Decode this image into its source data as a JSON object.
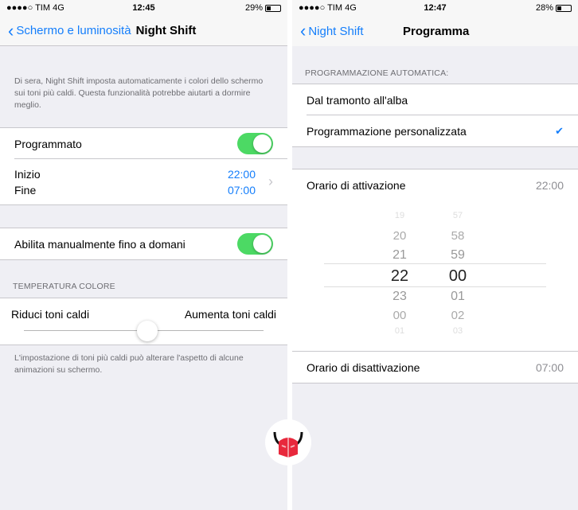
{
  "left": {
    "status": {
      "carrier": "●●●●○ TIM  4G",
      "time": "12:45",
      "battery": "29%",
      "battery_level": 0.29
    },
    "nav": {
      "back": "Schermo e luminosità",
      "title": "Night Shift"
    },
    "description": "Di sera, Night Shift imposta automaticamente i colori dello schermo sui toni più caldi. Questa funzionalità potrebbe aiutarti a dormire meglio.",
    "scheduled": {
      "label": "Programmato",
      "on": true
    },
    "start_label": "Inizio",
    "start_value": "22:00",
    "end_label": "Fine",
    "end_value": "07:00",
    "manual": {
      "label": "Abilita manualmente fino a domani",
      "on": true
    },
    "temp_header": "TEMPERATURA COLORE",
    "less_warm": "Riduci toni caldi",
    "more_warm": "Aumenta toni caldi",
    "temperature_level": 0.5,
    "temp_note": "L'impostazione di toni più caldi può alterare l'aspetto di alcune animazioni su schermo."
  },
  "right": {
    "status": {
      "carrier": "●●●●○ TIM  4G",
      "time": "12:47",
      "battery": "28%",
      "battery_level": 0.28
    },
    "nav": {
      "back": "Night Shift",
      "title": "Programma"
    },
    "auto_header": "PROGRAMMAZIONE AUTOMATICA:",
    "options": [
      {
        "label": "Dal tramonto all'alba",
        "selected": false
      },
      {
        "label": "Programmazione personalizzata",
        "selected": true
      }
    ],
    "checkmark": "✔",
    "on_label": "Orario di attivazione",
    "on_value": "22:00",
    "picker": {
      "hours": [
        "19",
        "20",
        "21",
        "22",
        "23",
        "00",
        "01"
      ],
      "minutes": [
        "57",
        "58",
        "59",
        "00",
        "01",
        "02",
        "03"
      ]
    },
    "off_label": "Orario di disattivazione",
    "off_value": "07:00"
  },
  "colors": {
    "accent": "#147efb",
    "toggle_on": "#4cd964",
    "logo_red": "#e8283c"
  }
}
